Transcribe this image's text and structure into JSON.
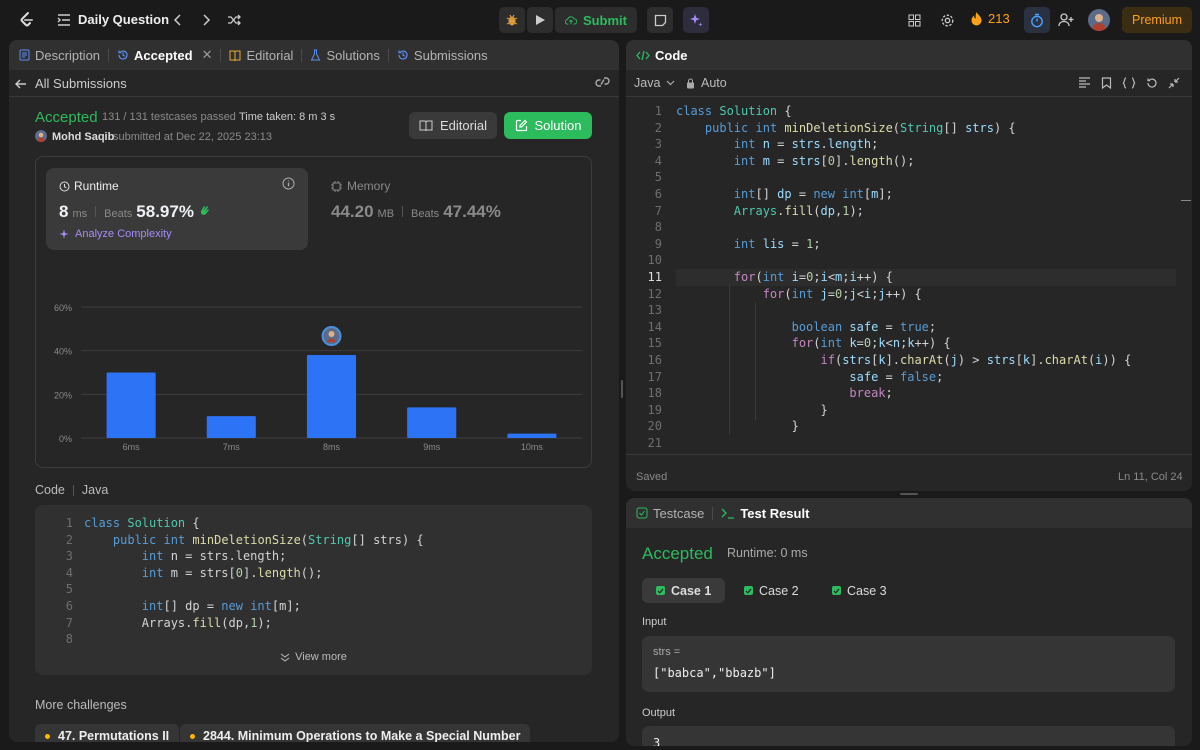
{
  "topbar": {
    "title": "Daily Question",
    "submit_label": "Submit",
    "streak": "213",
    "premium_label": "Premium"
  },
  "left_tabs": [
    {
      "label": "Description"
    },
    {
      "label": "Accepted"
    },
    {
      "label": "Editorial"
    },
    {
      "label": "Solutions"
    },
    {
      "label": "Submissions"
    }
  ],
  "submission": {
    "back_label": "All Submissions",
    "status": "Accepted",
    "testcases": "131 / 131 testcases passed",
    "time_taken": "Time taken: 8 m 3 s",
    "user": "Mohd Saqib",
    "submitted_at": "submitted at Dec 22, 2025 23:13",
    "editorial_btn": "Editorial",
    "solution_btn": "Solution"
  },
  "runtime": {
    "label": "Runtime",
    "value": "8",
    "unit": "ms",
    "beats_label": "Beats",
    "beats": "58.97%",
    "analyze": "Analyze Complexity"
  },
  "memory": {
    "label": "Memory",
    "value": "44.20",
    "unit": "MB",
    "beats_label": "Beats",
    "beats": "47.44%"
  },
  "chart_data": {
    "type": "bar",
    "categories": [
      "6ms",
      "7ms",
      "8ms",
      "9ms",
      "10ms"
    ],
    "values": [
      30,
      10,
      38,
      14,
      2
    ],
    "ylim": [
      0,
      60
    ],
    "yticks": [
      "60%",
      "40%",
      "20%",
      "0%"
    ],
    "highlight": "8ms",
    "bar_color": "#2d73f5",
    "grid": true
  },
  "overview_labels": [
    "6ms",
    "7ms",
    "8ms",
    "9ms",
    "10ms"
  ],
  "code_section": {
    "label": "Code",
    "lang": "Java",
    "view_more": "View more",
    "line_numbers": [
      "1",
      "2",
      "3",
      "4",
      "5",
      "6",
      "7",
      "8"
    ]
  },
  "more_challenges": {
    "label": "More challenges",
    "items": [
      {
        "label": "47. Permutations II"
      },
      {
        "label": "2844. Minimum Operations to Make a Special Number"
      }
    ]
  },
  "editor": {
    "title": "Code",
    "lang": "Java",
    "auto": "Auto",
    "status": "Saved",
    "cursor": "Ln 11, Col 24",
    "line_numbers": [
      "1",
      "2",
      "3",
      "4",
      "5",
      "6",
      "7",
      "8",
      "9",
      "10",
      "11",
      "12",
      "13",
      "14",
      "15",
      "16",
      "17",
      "18",
      "19",
      "20",
      "21"
    ]
  },
  "test": {
    "tab1": "Testcase",
    "tab2": "Test Result",
    "status": "Accepted",
    "runtime": "Runtime: 0 ms",
    "cases": [
      {
        "label": "Case 1"
      },
      {
        "label": "Case 2"
      },
      {
        "label": "Case 3"
      }
    ],
    "input_label": "Input",
    "input_var": "strs =",
    "input_value": "[\"babca\",\"bbazb\"]",
    "output_label": "Output",
    "output_value": "3"
  },
  "colors": {
    "accent_green": "#2cbb5d",
    "brand_orange": "#ffa116",
    "bar_blue": "#2d73f5"
  }
}
